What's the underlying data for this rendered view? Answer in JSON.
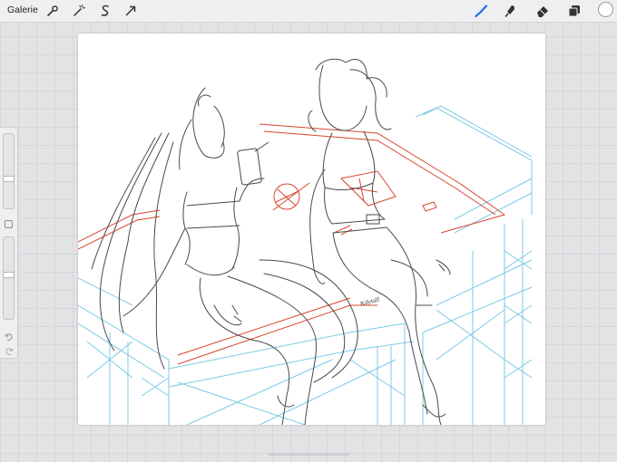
{
  "toolbar": {
    "gallery_label": "Galerie",
    "left_tools": [
      "wrench-icon",
      "magic-wand-icon",
      "selection-icon",
      "transform-arrow-icon"
    ],
    "right_tools": [
      "brush-icon",
      "smudge-icon",
      "eraser-icon",
      "layers-icon"
    ],
    "active_tool": "brush-icon",
    "active_color": "#ffffff",
    "accent": "#1e6fe8"
  },
  "sidebar": {
    "brush_size": 0.4,
    "brush_opacity": 0.55,
    "undo_icon": "undo-arrow-icon",
    "redo_icon": "redo-arrow-icon"
  },
  "canvas": {
    "signature_text": "Kdytalf",
    "line_color": "#4a4a4a",
    "guide_color": "#7cc9e6",
    "sketch_color": "#d9452c"
  }
}
